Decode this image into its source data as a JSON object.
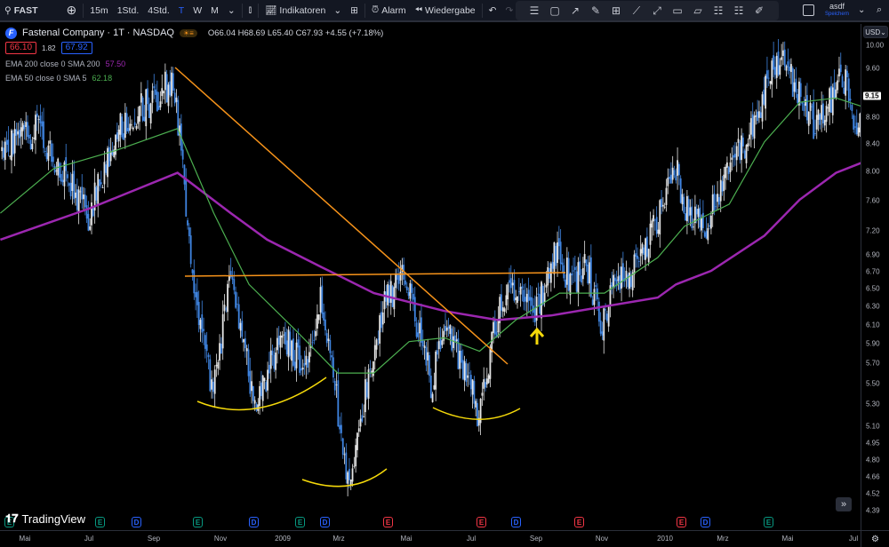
{
  "toolbar": {
    "symbol": "FAST",
    "timeframes": [
      "15m",
      "1Std.",
      "4Std.",
      "T",
      "W",
      "M"
    ],
    "active_timeframe": "T",
    "indicators": "Indikatoren",
    "alarm": "Alarm",
    "replay": "Wiedergabe",
    "layout_name": "asdf",
    "save": "Speichern"
  },
  "legend": {
    "title": "Fastenal Company · 1T · NASDAQ",
    "ohlc": "O66.04 H68.69 L65.40 C67.93 +4.55 (+7.18%)",
    "bid": "66.10",
    "spread": "1.82",
    "ask": "67.92",
    "ema200": {
      "label": "EMA 200 close 0 SMA 200",
      "value": "57.50",
      "color": "#9c27b0"
    },
    "ema50": {
      "label": "EMA 50 close 0 SMA 5",
      "value": "62.18",
      "color": "#4caf50"
    }
  },
  "currency": "USD",
  "last_price": "9.15",
  "logo_text": "TradingView",
  "colors": {
    "up": "#e6e6e6",
    "down": "#3f84e0",
    "trendline": "#f7931a",
    "arcs": "#f5d90a",
    "arrow": "#f5d90a"
  },
  "chart_data": {
    "type": "candlestick",
    "scale": "log",
    "ylim": [
      4.39,
      10.0
    ],
    "y_ticks": [
      "10.00",
      "9.60",
      "8.80",
      "8.40",
      "8.00",
      "7.60",
      "7.20",
      "6.90",
      "6.70",
      "6.50",
      "6.30",
      "6.10",
      "5.90",
      "5.70",
      "5.50",
      "5.30",
      "5.10",
      "4.95",
      "4.80",
      "4.66",
      "4.52",
      "4.39"
    ],
    "x_ticks": [
      "Mai",
      "Jul",
      "Sep",
      "Nov",
      "2009",
      "Mrz",
      "Mai",
      "Jul",
      "Sep",
      "Nov",
      "2010",
      "Mrz",
      "Mai",
      "Jul"
    ],
    "price_path": [
      [
        "2008-04-08",
        8.3
      ],
      [
        "2008-05-11",
        8.6
      ],
      [
        "2008-06-30",
        7.4
      ],
      [
        "2008-07-25",
        8.6
      ],
      [
        "2008-09-17",
        9.4
      ],
      [
        "2008-09-25",
        8.3
      ],
      [
        "2008-10-08",
        6.25
      ],
      [
        "2008-10-25",
        5.4
      ],
      [
        "2008-11-10",
        6.8
      ],
      [
        "2008-12-01",
        5.3
      ],
      [
        "2008-12-30",
        5.96
      ],
      [
        "2009-01-20",
        5.6
      ],
      [
        "2009-02-02",
        6.4
      ],
      [
        "2009-02-14",
        5.6
      ],
      [
        "2009-02-28",
        4.56
      ],
      [
        "2009-03-11",
        5.18
      ],
      [
        "2009-03-24",
        5.78
      ],
      [
        "2009-04-05",
        6.4
      ],
      [
        "2009-04-23",
        6.66
      ],
      [
        "2009-05-04",
        6.05
      ],
      [
        "2009-05-17",
        5.5
      ],
      [
        "2009-05-29",
        6.15
      ],
      [
        "2009-06-15",
        5.7
      ],
      [
        "2009-07-01",
        5.18
      ],
      [
        "2009-07-14",
        6.05
      ],
      [
        "2009-07-31",
        6.56
      ],
      [
        "2009-08-20",
        6.15
      ],
      [
        "2009-09-10",
        6.9
      ],
      [
        "2009-09-27",
        6.56
      ],
      [
        "2009-10-09",
        6.8
      ],
      [
        "2009-10-24",
        6.05
      ],
      [
        "2009-11-03",
        6.56
      ],
      [
        "2009-11-20",
        6.66
      ],
      [
        "2009-12-15",
        7.3
      ],
      [
        "2009-12-29",
        8.17
      ],
      [
        "2010-01-13",
        7.4
      ],
      [
        "2010-01-30",
        7.3
      ],
      [
        "2010-02-16",
        7.9
      ],
      [
        "2010-03-13",
        8.6
      ],
      [
        "2010-03-25",
        9.26
      ],
      [
        "2010-04-11",
        9.86
      ],
      [
        "2010-04-27",
        9.1
      ],
      [
        "2010-05-10",
        8.72
      ],
      [
        "2010-05-22",
        8.85
      ],
      [
        "2010-06-04",
        9.72
      ],
      [
        "2010-06-18",
        8.65
      ],
      [
        "2010-06-25",
        9.15
      ]
    ],
    "series": [
      {
        "name": "EMA 200",
        "color": "#9c27b0",
        "values": [
          [
            "2008-04-08",
            7.09
          ],
          [
            "2008-06-30",
            7.49
          ],
          [
            "2008-09-21",
            7.98
          ],
          [
            "2008-11-10",
            7.43
          ],
          [
            "2008-12-14",
            7.09
          ],
          [
            "2009-02-02",
            6.76
          ],
          [
            "2009-03-24",
            6.45
          ],
          [
            "2009-05-29",
            6.25
          ],
          [
            "2009-07-18",
            6.15
          ],
          [
            "2009-09-06",
            6.2
          ],
          [
            "2009-10-26",
            6.3
          ],
          [
            "2009-12-15",
            6.4
          ],
          [
            "2010-01-01",
            6.55
          ],
          [
            "2010-02-03",
            6.71
          ],
          [
            "2010-03-25",
            7.14
          ],
          [
            "2010-04-27",
            7.61
          ],
          [
            "2010-05-31",
            7.98
          ],
          [
            "2010-06-25",
            8.13
          ]
        ]
      },
      {
        "name": "EMA 50",
        "color": "#4caf50",
        "values": [
          [
            "2008-04-08",
            7.43
          ],
          [
            "2008-05-28",
            8.04
          ],
          [
            "2008-07-25",
            8.3
          ],
          [
            "2008-09-21",
            8.63
          ],
          [
            "2008-10-25",
            7.43
          ],
          [
            "2008-11-27",
            6.55
          ],
          [
            "2009-01-08",
            6.06
          ],
          [
            "2009-02-18",
            5.6
          ],
          [
            "2009-03-24",
            5.6
          ],
          [
            "2009-04-26",
            5.92
          ],
          [
            "2009-05-29",
            5.96
          ],
          [
            "2009-07-01",
            5.82
          ],
          [
            "2009-08-04",
            6.15
          ],
          [
            "2009-09-14",
            6.45
          ],
          [
            "2009-10-26",
            6.45
          ],
          [
            "2009-12-15",
            6.87
          ],
          [
            "2010-01-09",
            7.26
          ],
          [
            "2010-02-20",
            7.55
          ],
          [
            "2010-03-25",
            8.43
          ],
          [
            "2010-04-27",
            9.04
          ],
          [
            "2010-05-31",
            9.11
          ],
          [
            "2010-06-25",
            8.97
          ]
        ]
      }
    ]
  },
  "events": [
    {
      "t": "E",
      "c": "#089981"
    },
    {
      "t": "E",
      "c": "#089981"
    },
    {
      "t": "D",
      "c": "#2962ff"
    },
    {
      "t": "E",
      "c": "#089981"
    },
    {
      "t": "D",
      "c": "#2962ff"
    },
    {
      "t": "E",
      "c": "#089981"
    },
    {
      "t": "D",
      "c": "#2962ff"
    },
    {
      "t": "E",
      "c": "#f23645"
    },
    {
      "t": "E",
      "c": "#f23645"
    },
    {
      "t": "D",
      "c": "#2962ff"
    },
    {
      "t": "E",
      "c": "#f23645"
    },
    {
      "t": "E",
      "c": "#f23645"
    },
    {
      "t": "D",
      "c": "#2962ff"
    },
    {
      "t": "E",
      "c": "#089981"
    }
  ]
}
